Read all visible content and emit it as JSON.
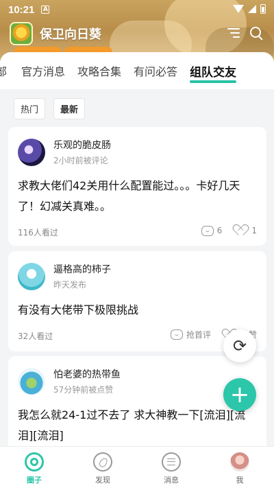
{
  "status_bar": {
    "time": "10:21",
    "notification": "A"
  },
  "app": {
    "title": "保卫向日葵"
  },
  "tabs": [
    {
      "label": "部",
      "active": false
    },
    {
      "label": "官方消息",
      "active": false
    },
    {
      "label": "攻略合集",
      "active": false
    },
    {
      "label": "有问必答",
      "active": false
    },
    {
      "label": "组队交友",
      "active": true
    }
  ],
  "sort": {
    "hot": "热门",
    "latest": "最新"
  },
  "posts": [
    {
      "author": "乐观的脆皮肠",
      "time": "2小时前被评论",
      "content": "求教大佬们42关用什么配置能过。。。卡好几天了！幻减关真难。。",
      "views": "116人看过",
      "comments": "6",
      "likes": "1"
    },
    {
      "author": "逼格高的柿子",
      "time": "昨天发布",
      "content": "有没有大佬带下极限挑战",
      "views": "32人看过",
      "comments": "抢首评",
      "likes": "点赞"
    },
    {
      "author": "怕老婆的热带鱼",
      "time": "57分钟前被点赞",
      "content": "我怎么就24-1过不去了 求大神教一下[流泪][流泪][流泪]"
    }
  ],
  "bottom_nav": [
    {
      "label": "圈子",
      "icon": "circle-icon",
      "active": true
    },
    {
      "label": "发现",
      "icon": "compass-icon",
      "active": false
    },
    {
      "label": "消息",
      "icon": "message-icon",
      "active": false
    },
    {
      "label": "我",
      "icon": "avatar-icon",
      "active": false
    }
  ],
  "colors": {
    "accent": "#2cc6ab",
    "header_bg": "#c9a45f"
  }
}
